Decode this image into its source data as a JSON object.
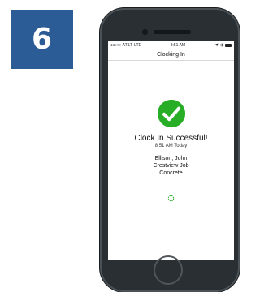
{
  "step": {
    "number": "6"
  },
  "status_bar": {
    "signal": "●●○○○",
    "carrier": "AT&T",
    "network": "LTE",
    "time": "8:51 AM"
  },
  "nav": {
    "title": "Clocking In"
  },
  "result": {
    "title": "Clock In Successful!",
    "time": "8:51 AM Today",
    "employee": "Ellison, John",
    "job": "Crestview Job",
    "task": "Concrete"
  },
  "icons": {
    "success": "check-circle-icon",
    "loading": "spinner-icon",
    "battery": "battery-icon"
  },
  "colors": {
    "badge": "#2b5c96",
    "success": "#27ae26",
    "spinner": "#3db43b"
  }
}
